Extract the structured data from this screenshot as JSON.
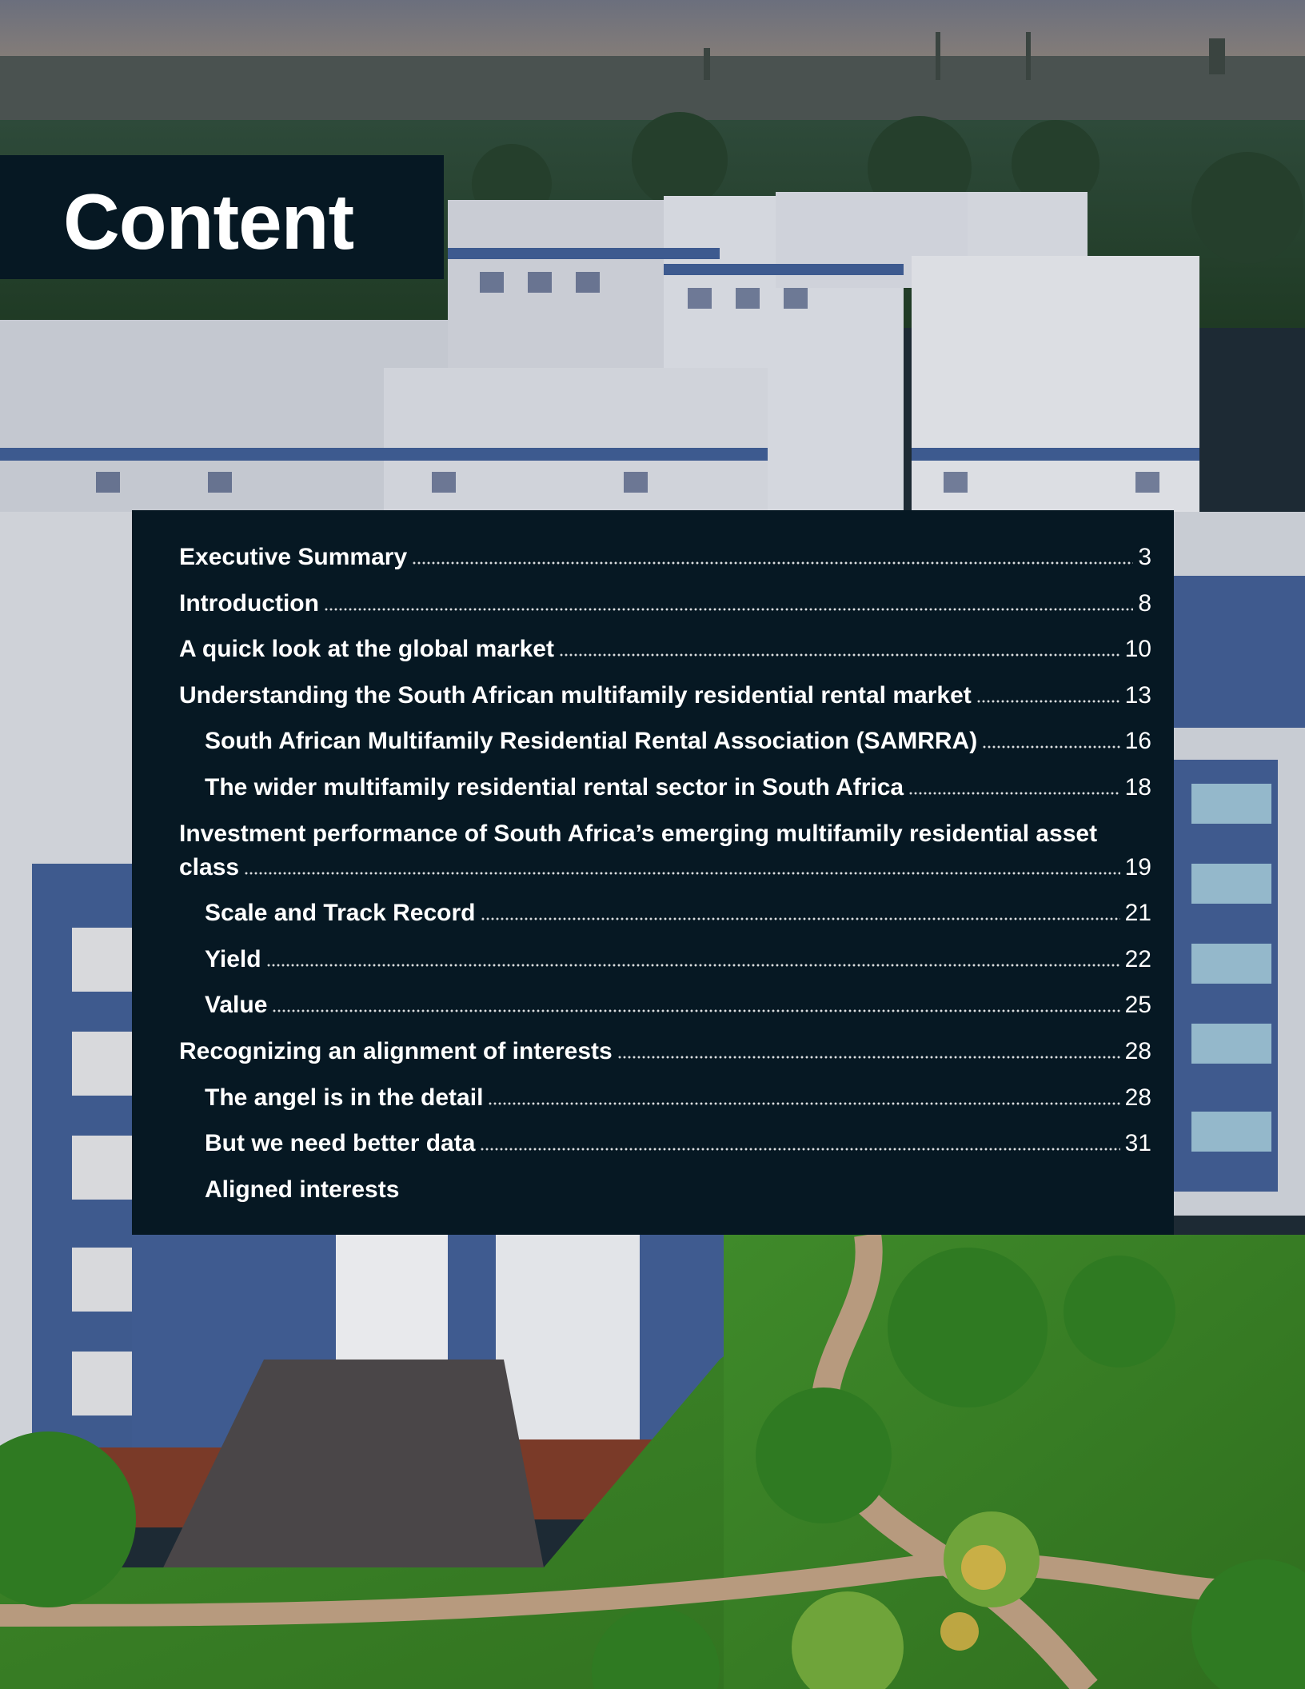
{
  "page": {
    "title": "Content"
  },
  "toc": {
    "items": [
      {
        "label": "Executive Summary",
        "page": "3",
        "level": 1
      },
      {
        "label": "Introduction",
        "page": "8",
        "level": 1
      },
      {
        "label": "A quick look at the global market",
        "page": "10",
        "level": 1
      },
      {
        "label": "Understanding the South African multifamily residential rental market",
        "page": "13",
        "level": 1
      },
      {
        "label": "South African Multifamily Residential Rental Association (SAMRRA)",
        "page": "16",
        "level": 2
      },
      {
        "label": "The wider multifamily residential rental sector in South Africa",
        "page": "18",
        "level": 2
      },
      {
        "label_line1": "Investment performance of South Africa’s emerging multifamily residential asset",
        "label_line2": "class",
        "page": "19",
        "level": 1
      },
      {
        "label": "Scale and Track Record",
        "page": "21",
        "level": 2
      },
      {
        "label": "Yield",
        "page": "22",
        "level": 2
      },
      {
        "label": "Value",
        "page": "25",
        "level": 2
      },
      {
        "label": "Recognizing an alignment of interests",
        "page": "28",
        "level": 1
      },
      {
        "label": "The angel is in the detail",
        "page": "28",
        "level": 2
      },
      {
        "label": "But we need better data",
        "page": "31",
        "level": 2
      },
      {
        "label": "Aligned interests",
        "page": "",
        "level": 2
      }
    ]
  },
  "colors": {
    "panel": "#061823",
    "text": "#ffffff"
  }
}
